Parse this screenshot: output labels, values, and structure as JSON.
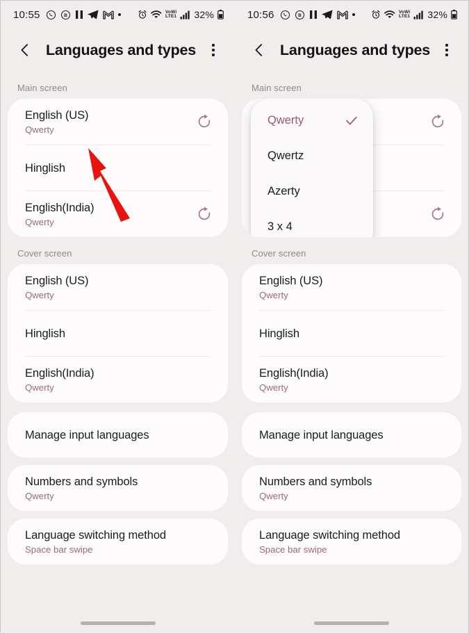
{
  "panels": [
    {
      "status_bar": {
        "time": "10:55",
        "left_icons": [
          "whatsapp-icon",
          "circle-b-icon",
          "pause-icon",
          "telegram-icon",
          "gmail-icon",
          "dot-icon"
        ],
        "alarm": "alarm-icon",
        "wifi": "wifi-icon",
        "network_label_top": "VoWi",
        "network_label_bottom": "LTE1",
        "signal": "signal-bars-icon",
        "battery_percent": "32%"
      },
      "app_bar": {
        "back_icon": "back-chevron-icon",
        "title": "Languages and types",
        "menu_icon": "more-options-icon"
      },
      "sections": [
        {
          "label": "Main screen",
          "rows": [
            {
              "title": "English (US)",
              "sub": "Qwerty",
              "reset": true
            },
            {
              "title": "Hinglish",
              "sub": "",
              "reset": false
            },
            {
              "title": "English(India)",
              "sub": "Qwerty",
              "reset": true
            }
          ]
        },
        {
          "label": "Cover screen",
          "rows": [
            {
              "title": "English (US)",
              "sub": "Qwerty",
              "reset": false
            },
            {
              "title": "Hinglish",
              "sub": "",
              "reset": false
            },
            {
              "title": "English(India)",
              "sub": "Qwerty",
              "reset": false
            }
          ]
        }
      ],
      "bottom_cards": [
        {
          "title": "Manage input languages",
          "sub": ""
        },
        {
          "title": "Numbers and symbols",
          "sub": "Qwerty"
        },
        {
          "title": "Language switching method",
          "sub": "Space bar swipe"
        }
      ],
      "annotation": {
        "type": "red-arrow",
        "color": "#e8130f",
        "points_to": "English (US)"
      },
      "dropdown": null
    },
    {
      "status_bar": {
        "time": "10:56",
        "left_icons": [
          "whatsapp-icon",
          "circle-b-icon",
          "pause-icon",
          "telegram-icon",
          "gmail-icon",
          "dot-icon"
        ],
        "alarm": "alarm-icon",
        "wifi": "wifi-icon",
        "network_label_top": "VoWi",
        "network_label_bottom": "LTE1",
        "signal": "signal-bars-icon",
        "battery_percent": "32%"
      },
      "app_bar": {
        "back_icon": "back-chevron-icon",
        "title": "Languages and types",
        "menu_icon": "more-options-icon"
      },
      "sections": [
        {
          "label": "Main screen",
          "rows": [
            {
              "title": "",
              "sub": "",
              "reset": true
            },
            {
              "title": "",
              "sub": "",
              "reset": false
            },
            {
              "title": "",
              "sub": "",
              "reset": true
            }
          ]
        },
        {
          "label": "Cover screen",
          "rows": [
            {
              "title": "English (US)",
              "sub": "Qwerty",
              "reset": false
            },
            {
              "title": "Hinglish",
              "sub": "",
              "reset": false
            },
            {
              "title": "English(India)",
              "sub": "Qwerty",
              "reset": false
            }
          ]
        }
      ],
      "bottom_cards": [
        {
          "title": "Manage input languages",
          "sub": ""
        },
        {
          "title": "Numbers and symbols",
          "sub": "Qwerty"
        },
        {
          "title": "Language switching method",
          "sub": "Space bar swipe"
        }
      ],
      "annotation": null,
      "dropdown": {
        "items": [
          {
            "label": "Qwerty",
            "selected": true
          },
          {
            "label": "Qwertz",
            "selected": false
          },
          {
            "label": "Azerty",
            "selected": false
          },
          {
            "label": "3 x 4",
            "selected": false
          }
        ]
      }
    }
  ],
  "colors": {
    "background": "#f1eded",
    "card": "#fdfbfb",
    "accent_subtitle": "#9c6b76",
    "accent_selected": "#9c5a68",
    "reset_icon": "#b07584",
    "annotation_red": "#e8130f"
  }
}
